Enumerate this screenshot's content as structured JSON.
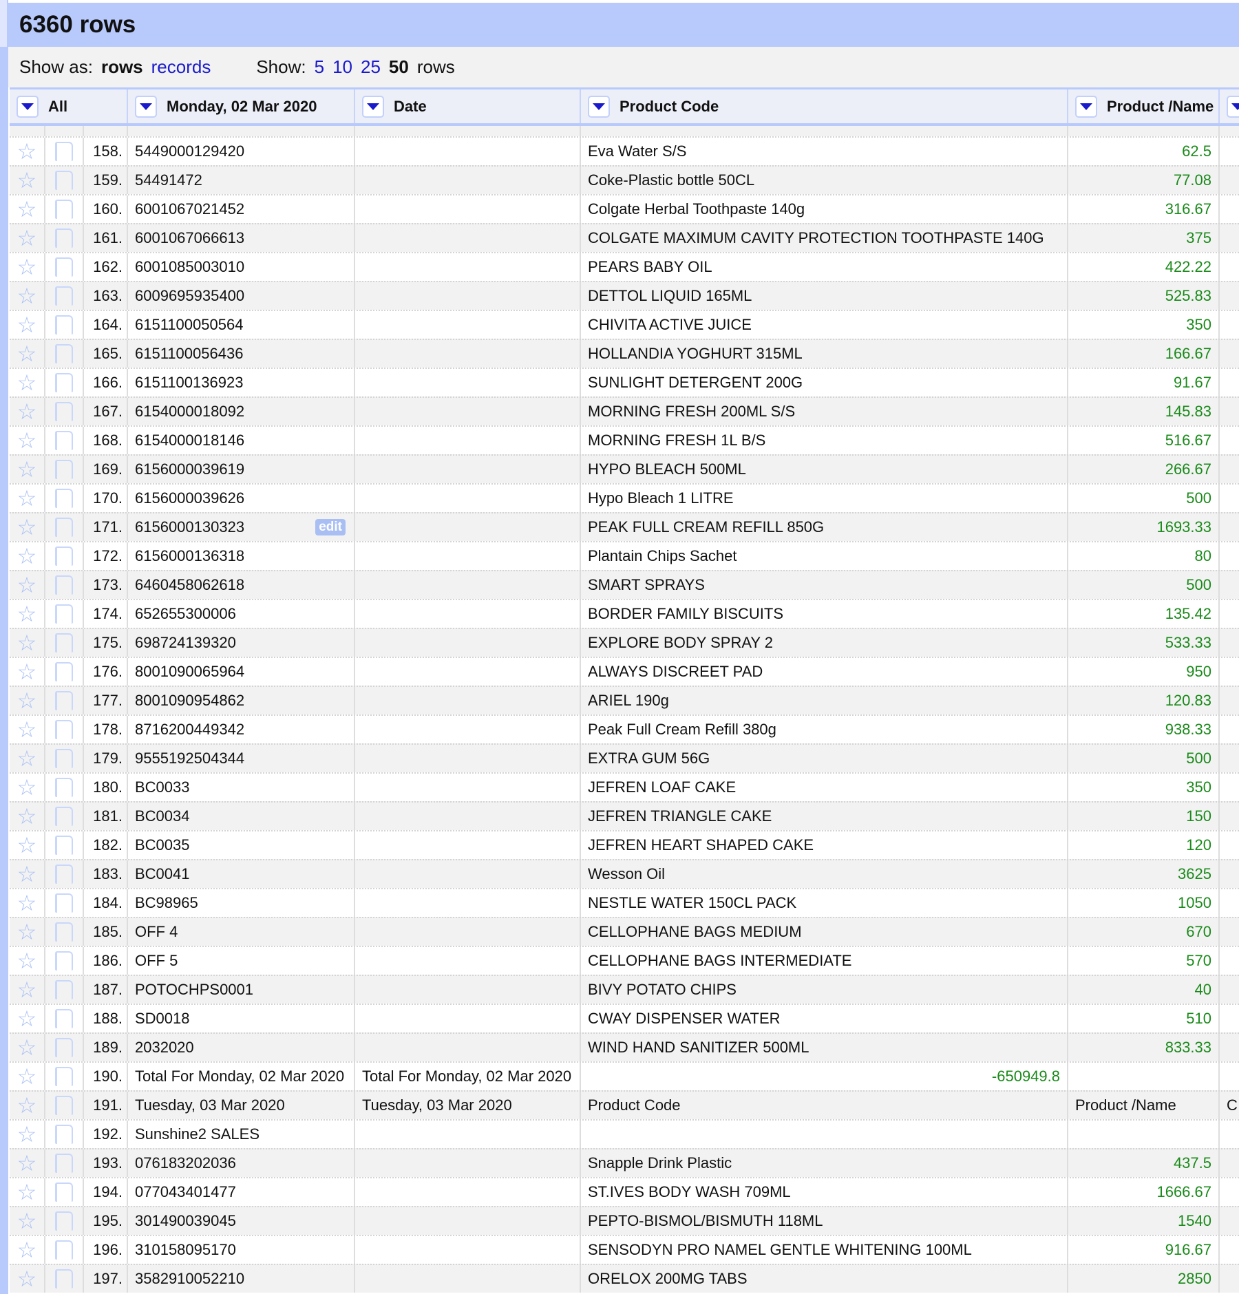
{
  "title": "6360 rows",
  "toolbar": {
    "show_as_label": "Show as:",
    "rows_label": "rows",
    "records_label": "records",
    "show_label": "Show:",
    "opt5": "5",
    "opt10": "10",
    "opt25": "25",
    "opt50": "50",
    "rows_suffix": "rows"
  },
  "columns": [
    "All",
    "Monday, 02 Mar 2020",
    "Date",
    "Product Code",
    "Product /Name"
  ],
  "colors": {
    "accent": "#b8c9fb",
    "link": "#1a1acc",
    "number": "#1a8a1a"
  },
  "edit_label": "edit",
  "rows": [
    [
      "158.",
      "5449000129420",
      "",
      "Eva Water S/S",
      "62.5"
    ],
    [
      "159.",
      "54491472",
      "",
      "Coke-Plastic bottle 50CL",
      "77.08"
    ],
    [
      "160.",
      "6001067021452",
      "",
      "Colgate Herbal Toothpaste 140g",
      "316.67"
    ],
    [
      "161.",
      "6001067066613",
      "",
      "COLGATE MAXIMUM CAVITY PROTECTION TOOTHPASTE 140G",
      "375"
    ],
    [
      "162.",
      "6001085003010",
      "",
      "PEARS BABY OIL",
      "422.22"
    ],
    [
      "163.",
      "6009695935400",
      "",
      "DETTOL LIQUID 165ML",
      "525.83"
    ],
    [
      "164.",
      "6151100050564",
      "",
      "CHIVITA ACTIVE JUICE",
      "350"
    ],
    [
      "165.",
      "6151100056436",
      "",
      "HOLLANDIA YOGHURT 315ML",
      "166.67"
    ],
    [
      "166.",
      "6151100136923",
      "",
      "SUNLIGHT DETERGENT 200G",
      "91.67"
    ],
    [
      "167.",
      "6154000018092",
      "",
      "MORNING FRESH 200ML S/S",
      "145.83"
    ],
    [
      "168.",
      "6154000018146",
      "",
      "MORNING FRESH 1L B/S",
      "516.67"
    ],
    [
      "169.",
      "6156000039619",
      "",
      "HYPO BLEACH 500ML",
      "266.67"
    ],
    [
      "170.",
      "6156000039626",
      "",
      "Hypo Bleach 1 LITRE",
      "500"
    ],
    [
      "171.",
      "6156000130323",
      "",
      "PEAK FULL CREAM REFILL 850G",
      "1693.33"
    ],
    [
      "172.",
      "6156000136318",
      "",
      "Plantain Chips Sachet",
      "80"
    ],
    [
      "173.",
      "6460458062618",
      "",
      "SMART SPRAYS",
      "500"
    ],
    [
      "174.",
      "652655300006",
      "",
      "BORDER FAMILY BISCUITS",
      "135.42"
    ],
    [
      "175.",
      "698724139320",
      "",
      "EXPLORE BODY SPRAY 2",
      "533.33"
    ],
    [
      "176.",
      "8001090065964",
      "",
      "ALWAYS DISCREET PAD",
      "950"
    ],
    [
      "177.",
      "8001090954862",
      "",
      "ARIEL 190g",
      "120.83"
    ],
    [
      "178.",
      "8716200449342",
      "",
      "Peak Full Cream Refill 380g",
      "938.33"
    ],
    [
      "179.",
      "9555192504344",
      "",
      "EXTRA GUM 56G",
      "500"
    ],
    [
      "180.",
      "BC0033",
      "",
      "JEFREN LOAF CAKE",
      "350"
    ],
    [
      "181.",
      "BC0034",
      "",
      "JEFREN TRIANGLE CAKE",
      "150"
    ],
    [
      "182.",
      "BC0035",
      "",
      "JEFREN HEART SHAPED CAKE",
      "120"
    ],
    [
      "183.",
      "BC0041",
      "",
      "Wesson Oil",
      "3625"
    ],
    [
      "184.",
      "BC98965",
      "",
      "NESTLE WATER 150CL PACK",
      "1050"
    ],
    [
      "185.",
      "OFF 4",
      "",
      "CELLOPHANE BAGS MEDIUM",
      "670"
    ],
    [
      "186.",
      "OFF 5",
      "",
      "CELLOPHANE BAGS INTERMEDIATE",
      "570"
    ],
    [
      "187.",
      "POTOCHPS0001",
      "",
      "BIVY POTATO CHIPS",
      "40"
    ],
    [
      "188.",
      "SD0018",
      "",
      "CWAY DISPENSER WATER",
      "510"
    ],
    [
      "189.",
      "2032020",
      "",
      "WIND HAND SANITIZER 500ML",
      "833.33"
    ],
    [
      "190.",
      "Total For Monday, 02 Mar 2020",
      "Total For Monday, 02 Mar 2020",
      "-650949.8",
      ""
    ],
    [
      "191.",
      "Tuesday, 03 Mar 2020",
      "Tuesday, 03 Mar 2020",
      "Product Code",
      "Product /Name",
      "C"
    ],
    [
      "192.",
      "Sunshine2  SALES",
      "",
      "",
      ""
    ],
    [
      "193.",
      "076183202036",
      "",
      "Snapple Drink Plastic",
      "437.5"
    ],
    [
      "194.",
      "077043401477",
      "",
      "ST.IVES BODY WASH 709ML",
      "1666.67"
    ],
    [
      "195.",
      "301490039045",
      "",
      "PEPTO-BISMOL/BISMUTH 118ML",
      "1540"
    ],
    [
      "196.",
      "310158095170",
      "",
      "SENSODYN PRO NAMEL GENTLE WHITENING 100ML",
      "916.67"
    ],
    [
      "197.",
      "3582910052210",
      "",
      "ORELOX 200MG TABS",
      "2850"
    ]
  ]
}
